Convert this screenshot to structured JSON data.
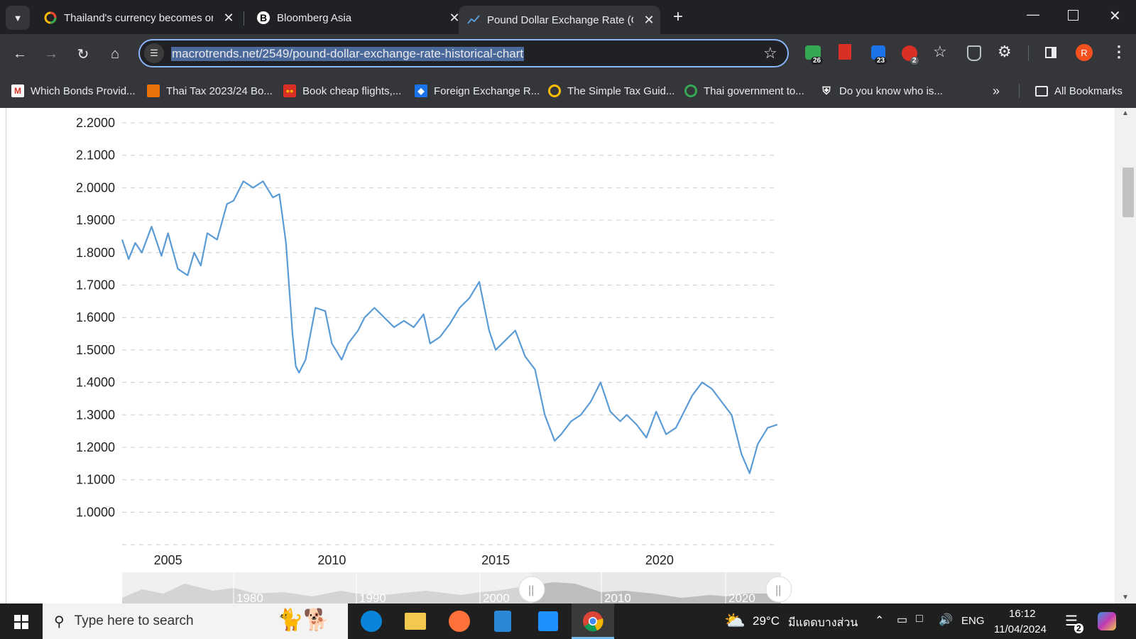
{
  "tabs": [
    {
      "title": "Thailand's currency becomes or",
      "icon": "google-news-icon"
    },
    {
      "title": "Bloomberg Asia",
      "icon": "bloomberg-icon",
      "glyph": "B"
    },
    {
      "title": "Pound Dollar Exchange Rate (G",
      "icon": "macrotrends-icon"
    }
  ],
  "toolbar": {
    "url": "macrotrends.net/2549/pound-dollar-exchange-rate-historical-chart",
    "ext_badges": [
      "26",
      "23",
      "2"
    ],
    "profile_initial": "R"
  },
  "bookmarks": [
    {
      "label": "Which Bonds Provid...",
      "icon": "gmail-icon"
    },
    {
      "label": "Thai Tax 2023/24 Bo...",
      "icon": "bookmark-icon"
    },
    {
      "label": "Book cheap flights,...",
      "icon": "airasia-icon"
    },
    {
      "label": "Foreign Exchange R...",
      "icon": "bookmark-icon"
    },
    {
      "label": "The Simple Tax Guid...",
      "icon": "google-icon"
    },
    {
      "label": "Thai government to...",
      "icon": "google-icon"
    },
    {
      "label": "Do you know who is...",
      "icon": "shield-icon"
    }
  ],
  "all_bookmarks": "All Bookmarks",
  "chart_data": {
    "type": "line",
    "ylim": [
      0.9,
      2.2
    ],
    "y_ticks": [
      "2.2000",
      "2.1000",
      "2.0000",
      "1.9000",
      "1.8000",
      "1.7000",
      "1.6000",
      "1.5000",
      "1.4000",
      "1.3000",
      "1.2000",
      "1.1000",
      "1.0000"
    ],
    "x_ticks": [
      "2005",
      "2010",
      "2015",
      "2020"
    ],
    "xlim": [
      2003.6,
      2023.6
    ],
    "series": [
      {
        "color": "#5b9bd5",
        "x": [
          2003.6,
          2003.8,
          2004.0,
          2004.2,
          2004.5,
          2004.8,
          2005.0,
          2005.3,
          2005.6,
          2005.8,
          2006.0,
          2006.2,
          2006.5,
          2006.8,
          2007.0,
          2007.3,
          2007.6,
          2007.9,
          2008.2,
          2008.4,
          2008.6,
          2008.8,
          2008.9,
          2009.0,
          2009.2,
          2009.5,
          2009.8,
          2010.0,
          2010.3,
          2010.5,
          2010.8,
          2011.0,
          2011.3,
          2011.6,
          2011.9,
          2012.2,
          2012.5,
          2012.8,
          2013.0,
          2013.3,
          2013.6,
          2013.9,
          2014.2,
          2014.5,
          2014.8,
          2015.0,
          2015.3,
          2015.6,
          2015.9,
          2016.2,
          2016.5,
          2016.8,
          2017.0,
          2017.3,
          2017.6,
          2017.9,
          2018.2,
          2018.5,
          2018.8,
          2019.0,
          2019.3,
          2019.6,
          2019.9,
          2020.2,
          2020.5,
          2020.8,
          2021.0,
          2021.3,
          2021.6,
          2021.9,
          2022.2,
          2022.5,
          2022.75,
          2023.0,
          2023.3,
          2023.6
        ],
        "y": [
          1.84,
          1.78,
          1.83,
          1.8,
          1.88,
          1.79,
          1.86,
          1.75,
          1.73,
          1.8,
          1.76,
          1.86,
          1.84,
          1.95,
          1.96,
          2.02,
          2.0,
          2.02,
          1.97,
          1.98,
          1.83,
          1.55,
          1.45,
          1.43,
          1.47,
          1.63,
          1.62,
          1.52,
          1.47,
          1.52,
          1.56,
          1.6,
          1.63,
          1.6,
          1.57,
          1.59,
          1.57,
          1.61,
          1.52,
          1.54,
          1.58,
          1.63,
          1.66,
          1.71,
          1.56,
          1.5,
          1.53,
          1.56,
          1.48,
          1.44,
          1.3,
          1.22,
          1.24,
          1.28,
          1.3,
          1.34,
          1.4,
          1.31,
          1.28,
          1.3,
          1.27,
          1.23,
          1.31,
          1.24,
          1.26,
          1.32,
          1.36,
          1.4,
          1.38,
          1.34,
          1.3,
          1.18,
          1.12,
          1.21,
          1.26,
          1.27
        ]
      }
    ]
  },
  "navigator": {
    "labels": [
      "1980",
      "1990",
      "2000",
      "2010",
      "2020"
    ]
  },
  "taskbar": {
    "search_placeholder": "Type here to search",
    "weather": "29°C",
    "weather_text": "มีแดดบางส่วน",
    "lang": "ENG",
    "time": "16:12",
    "date": "11/04/2024",
    "notif_count": "2"
  }
}
